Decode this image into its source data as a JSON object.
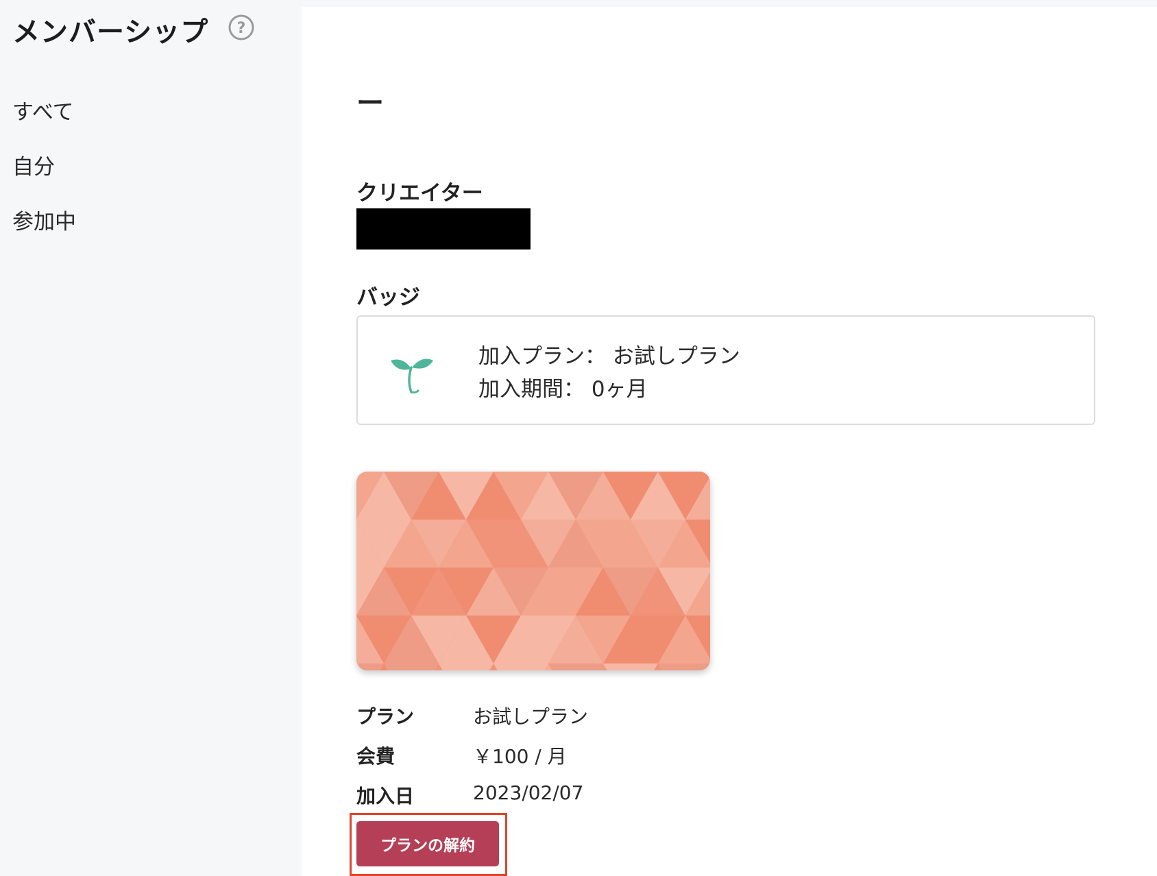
{
  "sidebar": {
    "title": "メンバーシップ",
    "help_icon": "question-circle-icon",
    "items": [
      {
        "label": "すべて"
      },
      {
        "label": "自分"
      },
      {
        "label": "参加中"
      }
    ]
  },
  "main": {
    "heading": "ー",
    "creator": {
      "label": "クリエイター",
      "value_redacted": true
    },
    "badge": {
      "label": "バッジ",
      "icon": "sprout-icon",
      "plan_line": "加入プラン：  お試しプラン",
      "period_line": "加入期間：  0ヶ月"
    },
    "plan_card": {
      "pattern": "geometric-triangle-pattern"
    },
    "details": {
      "plan_label": "プラン",
      "plan_value": "お試しプラン",
      "fee_label": "会費",
      "fee_value": "￥100 / 月",
      "joined_label": "加入日",
      "joined_value": "2023/02/07"
    },
    "cancel_button_label": "プランの解約"
  },
  "colors": {
    "sidebar_bg": "#f6f7f9",
    "main_bg": "#ffffff",
    "accent_button": "#b43f57",
    "highlight_border": "#e2442b",
    "sprout": "#4fb59b",
    "card_base": "#f1967c"
  }
}
